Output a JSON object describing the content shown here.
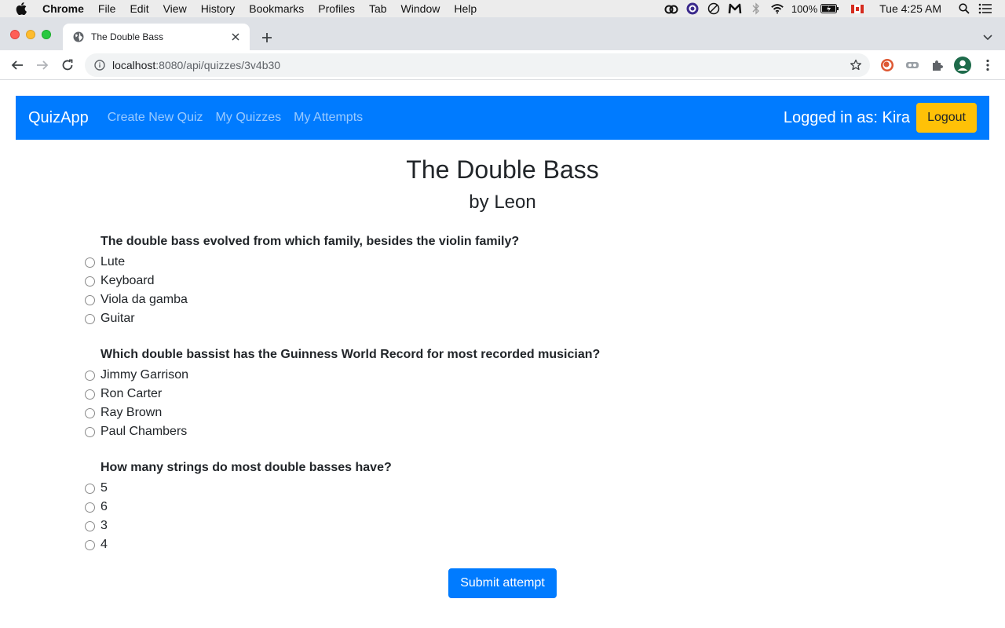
{
  "os_menubar": {
    "app_name": "Chrome",
    "items": [
      "File",
      "Edit",
      "View",
      "History",
      "Bookmarks",
      "Profiles",
      "Tab",
      "Window",
      "Help"
    ],
    "battery": "100%",
    "clock": "Tue 4:25 AM"
  },
  "browser": {
    "tab_title": "The Double Bass",
    "url_host": "localhost",
    "url_path": ":8080/api/quizzes/3v4b30"
  },
  "navbar": {
    "brand": "QuizApp",
    "links": [
      "Create New Quiz",
      "My Quizzes",
      "My Attempts"
    ],
    "logged_in": "Logged in as: Kira",
    "logout": "Logout"
  },
  "quiz": {
    "title": "The Double Bass",
    "author": "by Leon",
    "questions": [
      {
        "text": "The double bass evolved from which family, besides the violin family?",
        "options": [
          "Lute",
          "Keyboard",
          "Viola da gamba",
          "Guitar"
        ]
      },
      {
        "text": "Which double bassist has the Guinness World Record for most recorded musician?",
        "options": [
          "Jimmy Garrison",
          "Ron Carter",
          "Ray Brown",
          "Paul Chambers"
        ]
      },
      {
        "text": "How many strings do most double basses have?",
        "options": [
          "5",
          "6",
          "3",
          "4"
        ]
      }
    ],
    "submit": "Submit attempt"
  },
  "colors": {
    "primary": "#007bff",
    "warning": "#ffc107"
  }
}
